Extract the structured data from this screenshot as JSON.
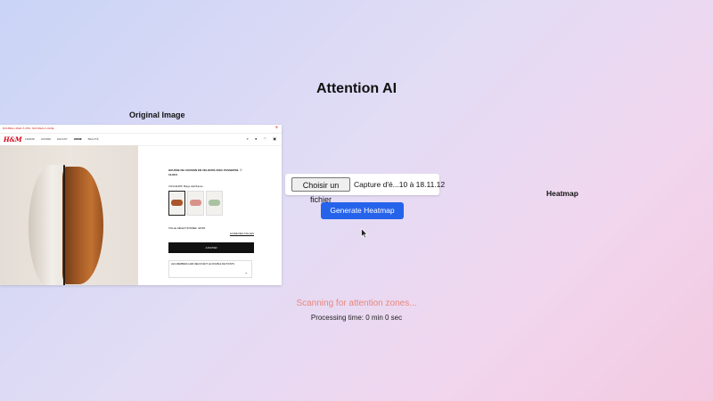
{
  "app": {
    "title": "Attention AI",
    "original_label": "Original Image",
    "heatmap_label": "Heatmap"
  },
  "screenshot": {
    "promo_text": "DOUBLE LIKEZ À 25%, NOUVEAU LIGNE",
    "logo": "H&M",
    "nav_items": [
      "FEMME",
      "HOMME",
      "ENFANT",
      "HOME",
      "BEAUTÉ"
    ],
    "nav_active": "HOME",
    "product": {
      "name": "HOUSSE DE COUSSIN EN VELOURS AVEC PASSEPOIL",
      "price": "12,99 €",
      "color_label": "COULEURS: Beige clair/Fauve",
      "size_label": "TAILLE SÉLECTIONNÉE: 40X60",
      "size_guide": "GUIDE DES TAILLES",
      "add_button": "AJOUTER",
      "member_text": "LES MEMBRES H&M REÇOIVENT LE DOUBLE DE POINTS"
    },
    "swatch_colors": [
      "#a9562a",
      "#d8938a",
      "#a9c3a3"
    ]
  },
  "controls": {
    "choose_file": "Choisir un fichier",
    "file_name": "Capture d'é...10 à 18.11.12",
    "generate_button": "Generate Heatmap"
  },
  "status": {
    "scanning": "Scanning for attention zones...",
    "processing": "Processing time: 0 min 0 sec"
  },
  "colors": {
    "accent": "#2563eb",
    "scanning_text": "#e7877f"
  }
}
